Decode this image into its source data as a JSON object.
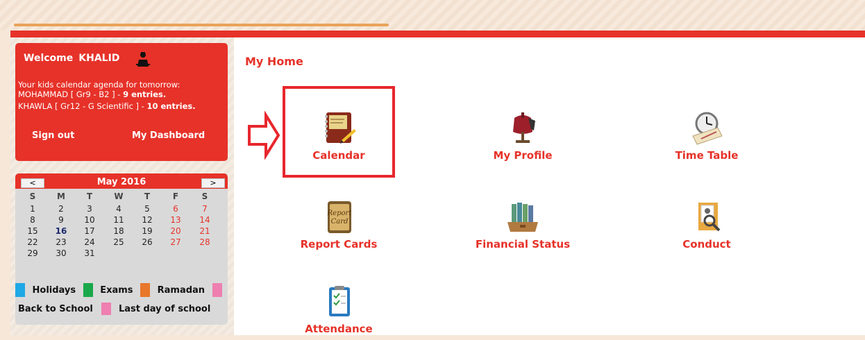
{
  "header": {},
  "welcome": {
    "greeting": "Welcome",
    "user": "KHALID",
    "agenda_intro": "Your kids calendar agenda for tomorrow:",
    "kids": [
      {
        "name": "MOHAMMAD [ Gr9 - B2 ] -",
        "entries": "9 entries."
      },
      {
        "name": "KHAWLA [ Gr12 - G Scientific ] -",
        "entries": "10 entries."
      }
    ],
    "sign_out": "Sign out",
    "dashboard": "My Dashboard"
  },
  "calendar": {
    "prev": "<",
    "next": ">",
    "title": "May 2016",
    "days_of_week": [
      "S",
      "M",
      "T",
      "W",
      "T",
      "F",
      "S"
    ],
    "weeks": [
      [
        "1",
        "2",
        "3",
        "4",
        "5",
        "6",
        "7"
      ],
      [
        "8",
        "9",
        "10",
        "11",
        "12",
        "13",
        "14"
      ],
      [
        "15",
        "16",
        "17",
        "18",
        "19",
        "20",
        "21"
      ],
      [
        "22",
        "23",
        "24",
        "25",
        "26",
        "27",
        "28"
      ],
      [
        "29",
        "30",
        "31",
        "",
        "",
        "",
        ""
      ]
    ],
    "today": "16",
    "legend": [
      {
        "label": "Holidays",
        "color": "#1ea8e6"
      },
      {
        "label": "Exams",
        "color": "#1aa84a"
      },
      {
        "label": "Ramadan",
        "color": "#e8772a"
      },
      {
        "label": "Back to School",
        "color": "#ee7fb0"
      },
      {
        "label": "Last day of school",
        "color": "#ee7fb0"
      }
    ]
  },
  "main": {
    "title": "My Home",
    "tiles": [
      {
        "label": "Calendar",
        "icon": "calendar-notebook-icon"
      },
      {
        "label": "My Profile",
        "icon": "profile-mannequin-icon"
      },
      {
        "label": "Time Table",
        "icon": "clock-timetable-icon"
      },
      {
        "label": "Report Cards",
        "icon": "report-card-icon"
      },
      {
        "label": "Financial Status",
        "icon": "binders-icon"
      },
      {
        "label": "Conduct",
        "icon": "conduct-folder-icon"
      },
      {
        "label": "Attendance",
        "icon": "attendance-clipboard-icon"
      }
    ]
  },
  "colors": {
    "accent": "#e63229",
    "highlight_box": "#e8262d"
  }
}
